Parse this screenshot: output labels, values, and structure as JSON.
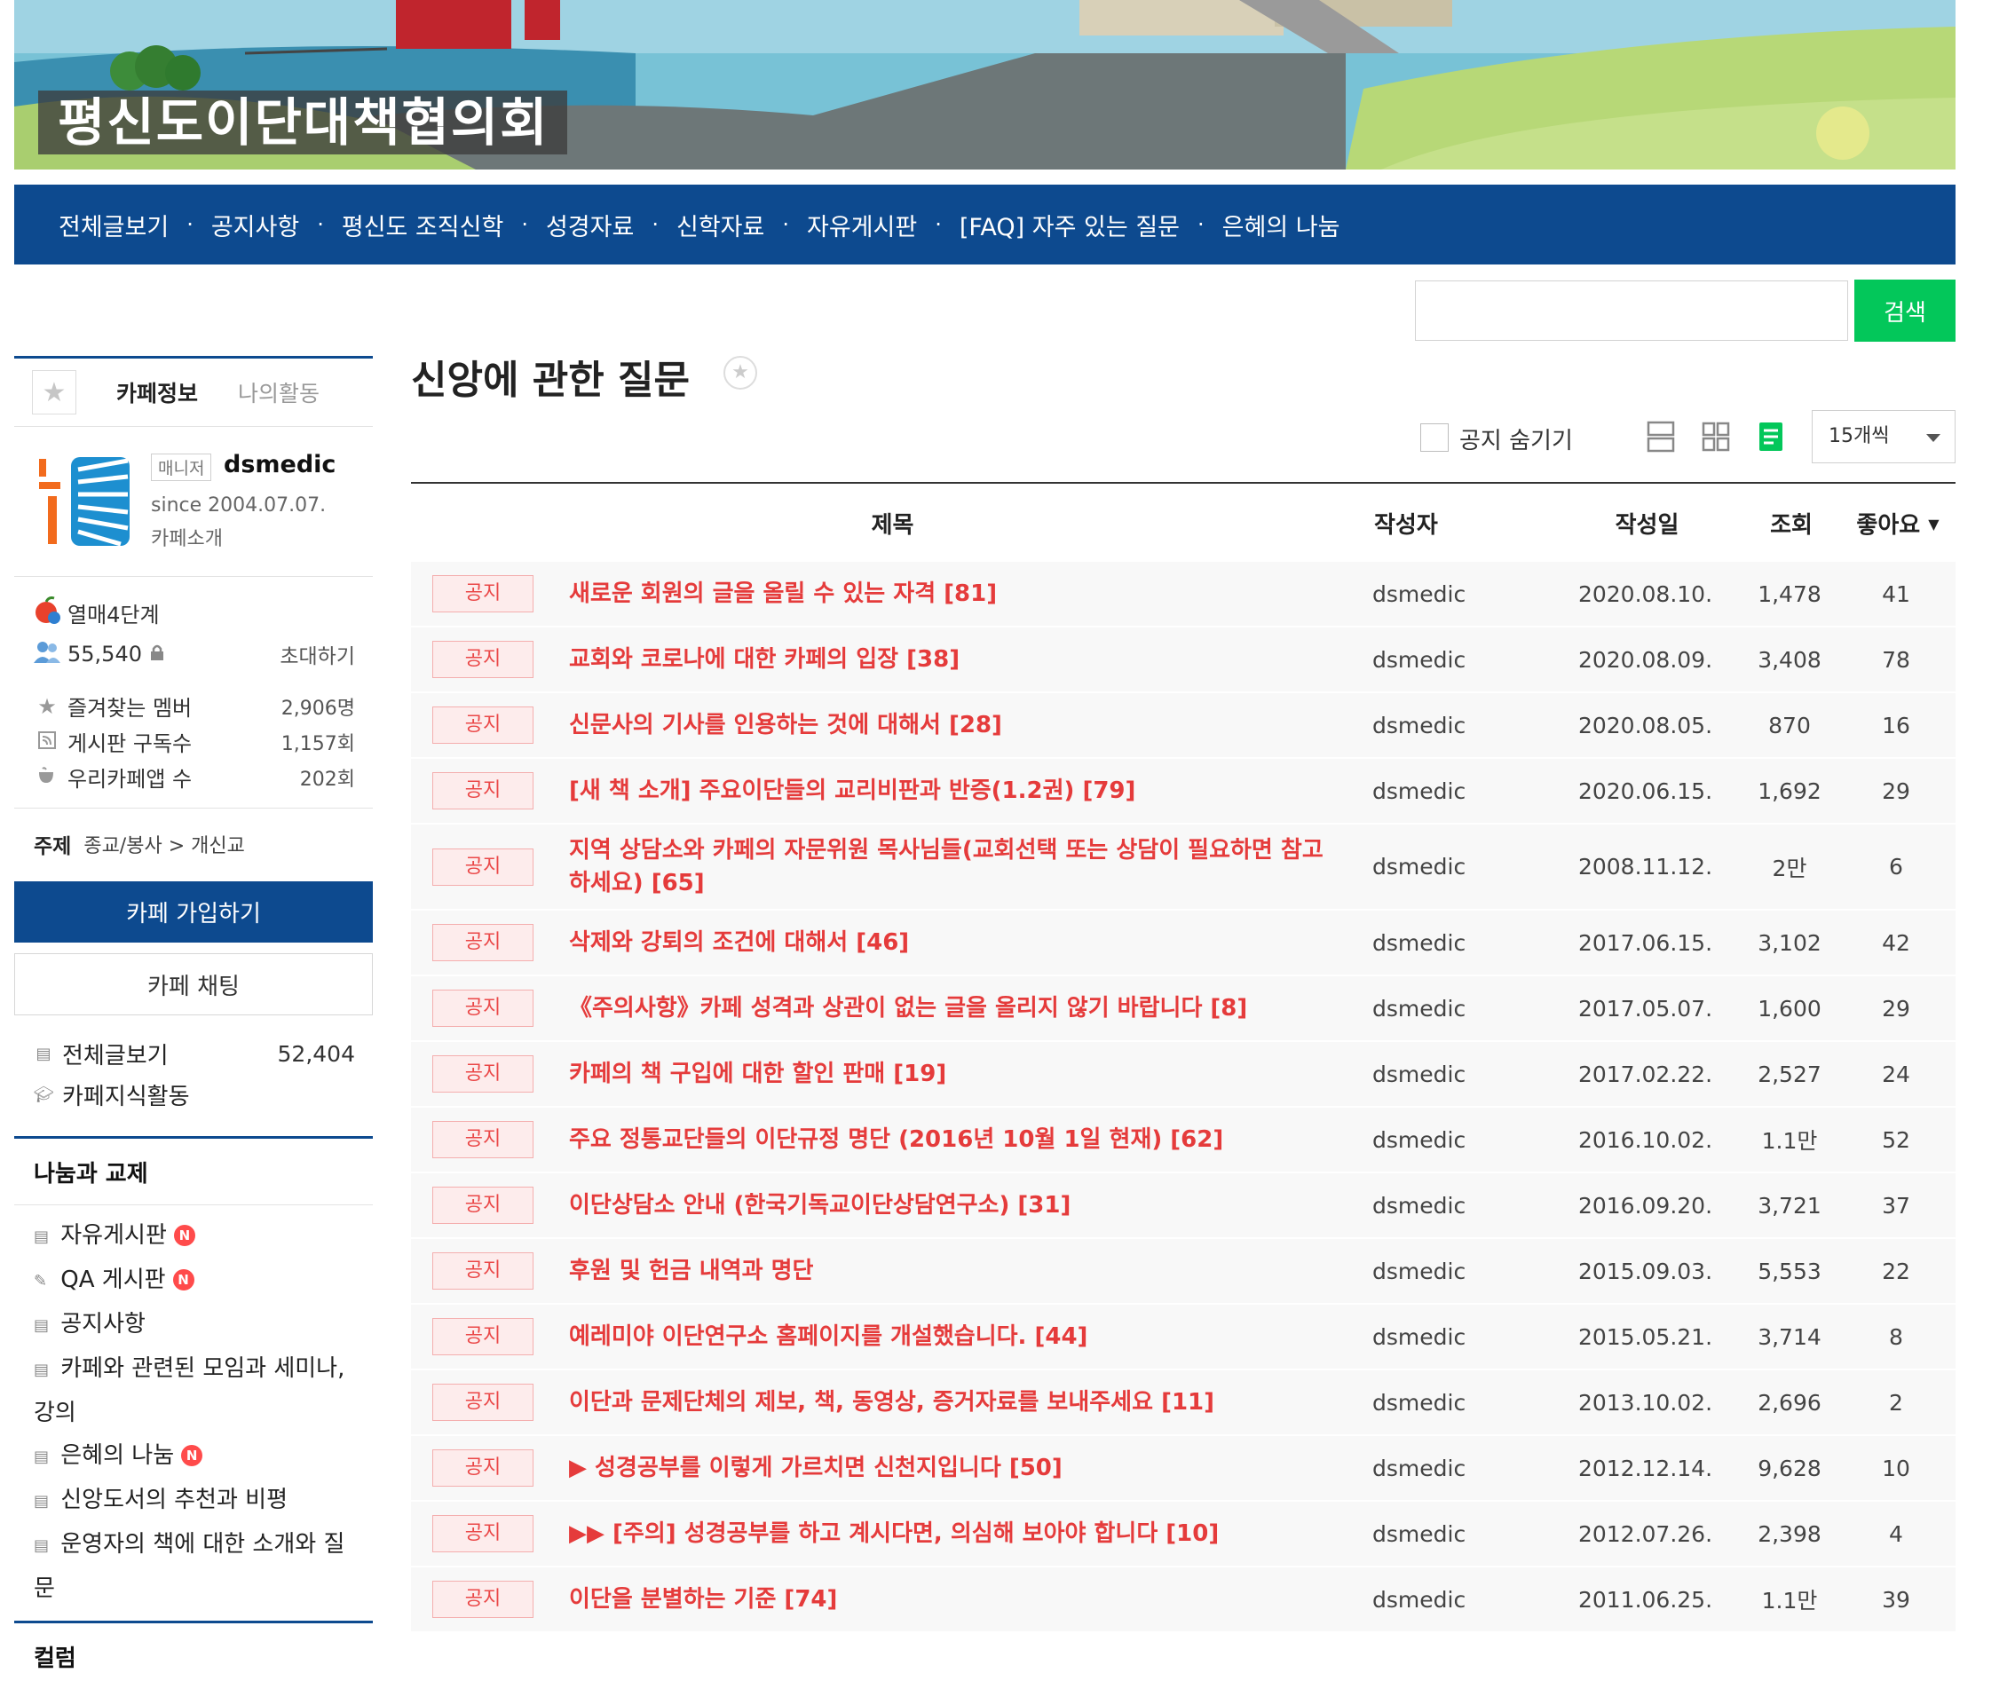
{
  "cafe": {
    "name": "평신도이단대책협의회"
  },
  "nav": {
    "items": [
      "전체글보기",
      "공지사항",
      "평신도 조직신학",
      "성경자료",
      "신학자료",
      "자유게시판",
      "[FAQ] 자주 있는 질문",
      "은혜의 나눔"
    ],
    "separator": "·"
  },
  "search": {
    "button_label": "검색",
    "value": ""
  },
  "sidebar": {
    "tabs": {
      "cafe_info": "카페정보",
      "my_activity": "나의활동"
    },
    "manager_badge": "매니저",
    "manager_name": "dsmedic",
    "since": "since 2004.07.07.",
    "intro": "카페소개",
    "level": "열매4단계",
    "members": "55,540",
    "invite": "초대하기",
    "favorite_members_label": "즐겨찾는 멤버",
    "favorite_members_value": "2,906명",
    "subscribers_label": "게시판 구독수",
    "subscribers_value": "1,157회",
    "app_label": "우리카페앱 수",
    "app_value": "202회",
    "topic_label": "주제",
    "topic_value": "종교/봉사 > 개신교",
    "join_button": "카페 가입하기",
    "chat_button": "카페 채팅",
    "all_posts_label": "전체글보기",
    "all_posts_count": "52,404",
    "knowledge_label": "카페지식활동",
    "section1_title": "나눔과 교제",
    "boards": [
      {
        "label": "자유게시판",
        "new": "N"
      },
      {
        "label": "QA 게시판",
        "new": "N"
      },
      {
        "label": "공지사항",
        "new": ""
      },
      {
        "label": "카페와 관련된 모임과 세미나, 강의",
        "new": ""
      },
      {
        "label": "은혜의 나눔",
        "new": "N"
      },
      {
        "label": "신앙도서의 추천과 비평",
        "new": ""
      },
      {
        "label": "운영자의 책에 대한 소개와 질문",
        "new": ""
      }
    ],
    "section2_title": "컬럼"
  },
  "board": {
    "title": "신앙에 관한 질문",
    "hide_notice_label": "공지 숨기기",
    "per_page": "15개씩",
    "columns": {
      "title": "제목",
      "author": "작성자",
      "date": "작성일",
      "views": "조회",
      "likes": "좋아요"
    },
    "rows": [
      {
        "badge": "공지",
        "title": "새로운 회원의 글을 올릴 수 있는 자격 [81]",
        "author": "dsmedic",
        "date": "2020.08.10.",
        "views": "1,478",
        "likes": "41"
      },
      {
        "badge": "공지",
        "title": "교회와 코로나에 대한 카페의 입장 [38]",
        "author": "dsmedic",
        "date": "2020.08.09.",
        "views": "3,408",
        "likes": "78"
      },
      {
        "badge": "공지",
        "title": "신문사의 기사를 인용하는 것에 대해서 [28]",
        "author": "dsmedic",
        "date": "2020.08.05.",
        "views": "870",
        "likes": "16"
      },
      {
        "badge": "공지",
        "title": "[새 책 소개] 주요이단들의 교리비판과 반증(1.2권) [79]",
        "author": "dsmedic",
        "date": "2020.06.15.",
        "views": "1,692",
        "likes": "29"
      },
      {
        "badge": "공지",
        "title": "지역 상담소와 카페의 자문위원 목사님들(교회선택 또는 상담이 필요하면 참고하세요) [65]",
        "author": "dsmedic",
        "date": "2008.11.12.",
        "views": "2만",
        "likes": "6"
      },
      {
        "badge": "공지",
        "title": "삭제와 강퇴의 조건에 대해서 [46]",
        "author": "dsmedic",
        "date": "2017.06.15.",
        "views": "3,102",
        "likes": "42"
      },
      {
        "badge": "공지",
        "title": "《주의사항》카페 성격과 상관이 없는 글을 올리지 않기 바랍니다 [8]",
        "author": "dsmedic",
        "date": "2017.05.07.",
        "views": "1,600",
        "likes": "29"
      },
      {
        "badge": "공지",
        "title": "카페의 책 구입에 대한 할인 판매 [19]",
        "author": "dsmedic",
        "date": "2017.02.22.",
        "views": "2,527",
        "likes": "24"
      },
      {
        "badge": "공지",
        "title": "주요 정통교단들의 이단규정 명단 (2016년 10월 1일 현재) [62]",
        "author": "dsmedic",
        "date": "2016.10.02.",
        "views": "1.1만",
        "likes": "52"
      },
      {
        "badge": "공지",
        "title": "이단상담소 안내 (한국기독교이단상담연구소) [31]",
        "author": "dsmedic",
        "date": "2016.09.20.",
        "views": "3,721",
        "likes": "37"
      },
      {
        "badge": "공지",
        "title": "후원 및 헌금 내역과 명단",
        "author": "dsmedic",
        "date": "2015.09.03.",
        "views": "5,553",
        "likes": "22"
      },
      {
        "badge": "공지",
        "title": "예레미야 이단연구소 홈페이지를 개설했습니다. [44]",
        "author": "dsmedic",
        "date": "2015.05.21.",
        "views": "3,714",
        "likes": "8"
      },
      {
        "badge": "공지",
        "title": "이단과 문제단체의 제보, 책, 동영상, 증거자료를 보내주세요 [11]",
        "author": "dsmedic",
        "date": "2013.10.02.",
        "views": "2,696",
        "likes": "2"
      },
      {
        "badge": "공지",
        "title": "▶ 성경공부를 이렇게 가르치면 신천지입니다 [50]",
        "author": "dsmedic",
        "date": "2012.12.14.",
        "views": "9,628",
        "likes": "10"
      },
      {
        "badge": "공지",
        "title": "▶▶ [주의] 성경공부를 하고 계시다면, 의심해 보아야 합니다 [10]",
        "author": "dsmedic",
        "date": "2012.07.26.",
        "views": "2,398",
        "likes": "4"
      },
      {
        "badge": "공지",
        "title": "이단을 분별하는 기준 [74]",
        "author": "dsmedic",
        "date": "2011.06.25.",
        "views": "1.1만",
        "likes": "39"
      }
    ]
  },
  "colors": {
    "nav_blue": "#0d4a8f",
    "search_green": "#03c75a",
    "notice_red": "#e53b3b"
  }
}
